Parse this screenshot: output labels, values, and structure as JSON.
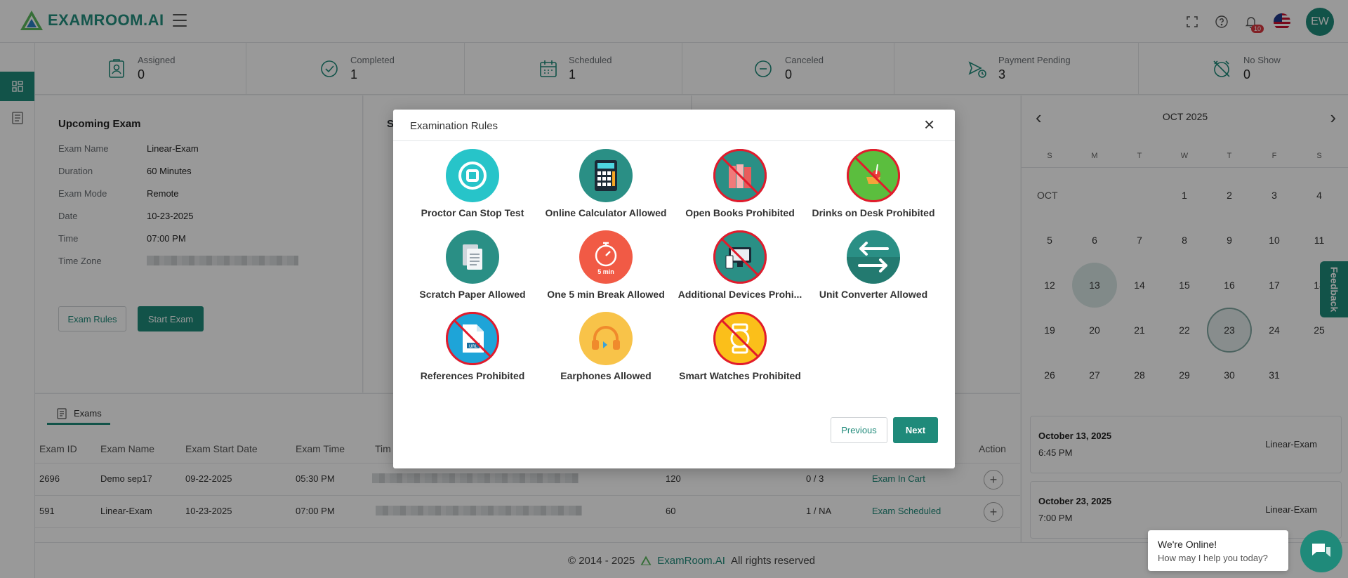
{
  "header": {
    "brand": "EXAMROOM.AI",
    "notif_count": "10",
    "user_initials": "EW"
  },
  "stats": [
    {
      "label": "Assigned",
      "value": "0"
    },
    {
      "label": "Completed",
      "value": "1"
    },
    {
      "label": "Scheduled",
      "value": "1"
    },
    {
      "label": "Canceled",
      "value": "0"
    },
    {
      "label": "Payment Pending",
      "value": "3"
    },
    {
      "label": "No Show",
      "value": "0"
    }
  ],
  "upcoming": {
    "title": "Upcoming Exam",
    "exam_name_label": "Exam Name",
    "exam_name": "Linear-Exam",
    "duration_label": "Duration",
    "duration": "60 Minutes",
    "mode_label": "Exam Mode",
    "mode": "Remote",
    "date_label": "Date",
    "date": "10-23-2025",
    "time_label": "Time",
    "time": "07:00 PM",
    "tz_label": "Time Zone",
    "rules_button": "Exam Rules",
    "start_button": "Start Exam",
    "second_panel_initial": "S"
  },
  "exams": {
    "tab": "Exams",
    "columns": [
      "Exam ID",
      "Exam Name",
      "Exam Start Date",
      "Exam Time",
      "Tim",
      "Action"
    ],
    "rows": [
      {
        "id": "2696",
        "name": "Demo sep17",
        "date": "09-22-2025",
        "time": "05:30 PM",
        "duration": "120",
        "attempts": "0 / 3",
        "status": "Exam In Cart"
      },
      {
        "id": "591",
        "name": "Linear-Exam",
        "date": "10-23-2025",
        "time": "07:00 PM",
        "duration": "60",
        "attempts": "1 / NA",
        "status": "Exam Scheduled"
      }
    ]
  },
  "calendar": {
    "title": "OCT 2025",
    "month_label": "OCT",
    "dow": [
      "S",
      "M",
      "T",
      "W",
      "T",
      "F",
      "S"
    ],
    "events": [
      {
        "date": "October 13, 2025",
        "time": "6:45 PM",
        "name": "Linear-Exam"
      },
      {
        "date": "October 23, 2025",
        "time": "7:00 PM",
        "name": "Linear-Exam"
      }
    ]
  },
  "footer": {
    "copy": "© 2014 - 2025",
    "brand": "ExamRoom.AI",
    "rights": "All rights reserved"
  },
  "feedback": "Feedback",
  "chat": {
    "line1": "We're Online!",
    "line2": "How may I help you today?"
  },
  "modal": {
    "title": "Examination Rules",
    "rules": [
      {
        "label": "Proctor Can Stop Test",
        "icon": "stop-icon"
      },
      {
        "label": "Online Calculator Allowed",
        "icon": "calculator-icon"
      },
      {
        "label": "Open Books Prohibited",
        "icon": "books-icon"
      },
      {
        "label": "Drinks on Desk Prohibited",
        "icon": "drink-icon"
      },
      {
        "label": "Scratch Paper Allowed",
        "icon": "paper-icon"
      },
      {
        "label": "One 5 min Break Allowed",
        "icon": "stopwatch-icon",
        "badge": "5 min"
      },
      {
        "label": "Additional Devices Prohi...",
        "icon": "devices-icon"
      },
      {
        "label": "Unit Converter Allowed",
        "icon": "converter-icon"
      },
      {
        "label": "References Prohibited",
        "icon": "document-icon"
      },
      {
        "label": "Earphones Allowed",
        "icon": "earphones-icon"
      },
      {
        "label": "Smart Watches Prohibited",
        "icon": "smartwatch-icon"
      }
    ],
    "previous": "Previous",
    "next": "Next"
  }
}
